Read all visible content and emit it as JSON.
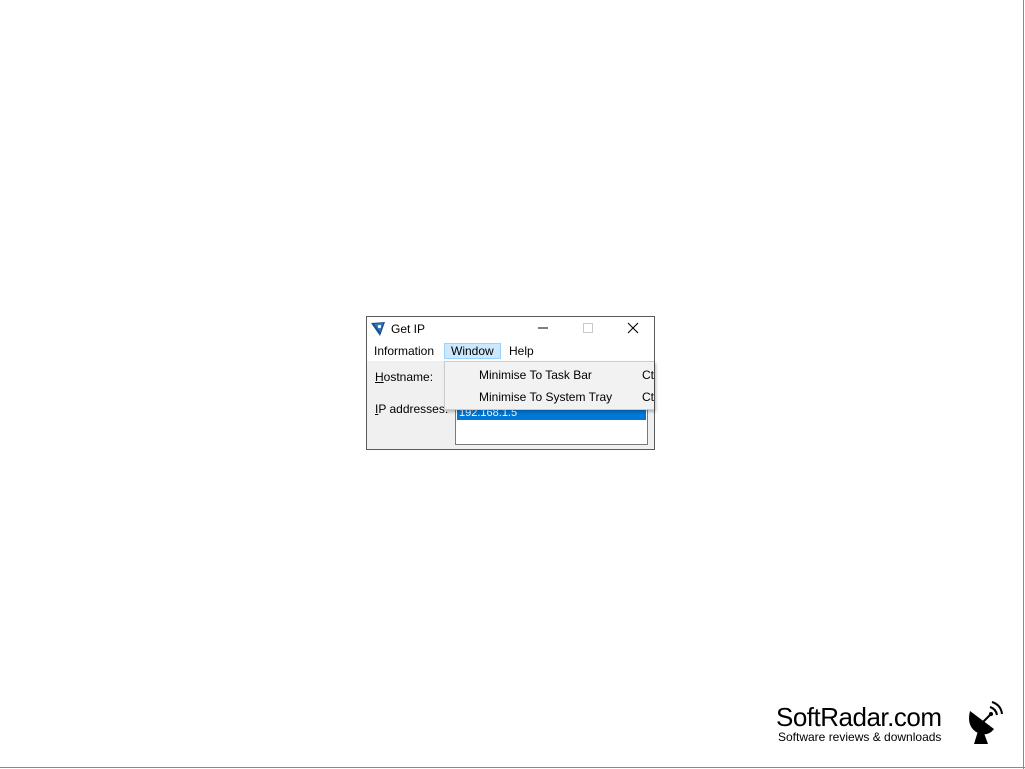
{
  "window": {
    "title": "Get IP",
    "app_icon": "get-ip-arrow-icon",
    "controls": {
      "minimize": "minimize-icon",
      "maximize": "maximize-icon",
      "close": "close-icon"
    }
  },
  "menubar": {
    "items": [
      {
        "label": "Information"
      },
      {
        "label": "Window",
        "active": true
      },
      {
        "label": "Help"
      }
    ]
  },
  "form": {
    "hostname_label": "Hostname:",
    "ip_label": "IP addresses:",
    "ip_list": [
      "192.168.1.5"
    ]
  },
  "dropdown": {
    "items": [
      {
        "label": "Minimise To Task Bar",
        "shortcut": "Ctr"
      },
      {
        "label": "Minimise To System Tray",
        "shortcut": "Ctr"
      }
    ]
  },
  "watermark": {
    "title": "SoftRadar.com",
    "subtitle": "Software reviews & downloads",
    "icon": "satellite-dish-icon"
  },
  "colors": {
    "selection": "#0078d7",
    "menu_highlight": "#cce8ff"
  }
}
